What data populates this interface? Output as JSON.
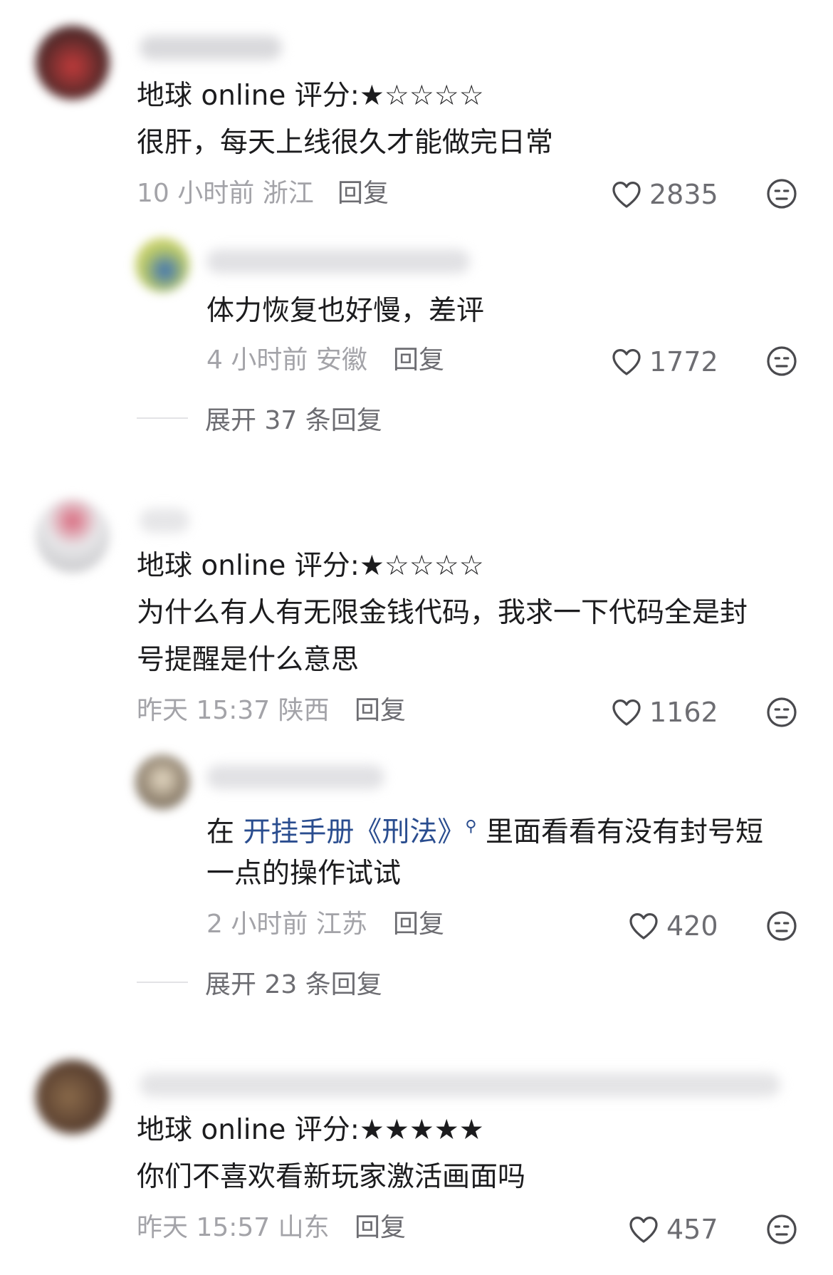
{
  "comments": [
    {
      "rating_line": "地球 online 评分:★☆☆☆☆",
      "body": "很肝，每天上线很久才能做完日常",
      "time": "10 小时前",
      "location": "浙江",
      "reply_label": "回复",
      "likes": "2835",
      "replies": [
        {
          "body": "体力恢复也好慢，差评",
          "time": "4 小时前",
          "location": "安徽",
          "reply_label": "回复",
          "likes": "1772"
        }
      ],
      "expand_label": "展开 37 条回复"
    },
    {
      "rating_line": "地球 online  评分:★☆☆☆☆",
      "body_line1": "为什么有人有无限金钱代码，我求一下代码全是封",
      "body_line2": "号提醒是什么意思",
      "time": "昨天 15:37",
      "location": "陕西",
      "reply_label": "回复",
      "likes": "1162",
      "replies": [
        {
          "body_prefix": "在 ",
          "body_link": "开挂手册《刑法》",
          "body_rest": " 里面看看有没有封号短",
          "body_line2": "一点的操作试试",
          "time": "2 小时前",
          "location": "江苏",
          "reply_label": "回复",
          "likes": "420"
        }
      ],
      "expand_label": "展开 23 条回复"
    },
    {
      "rating_line": "地球 online 评分:★★★★★",
      "body": "你们不喜欢看新玩家激活画面吗",
      "time": "昨天 15:57",
      "location": "山东",
      "reply_label": "回复",
      "likes": "457"
    }
  ],
  "icons": {
    "like": "heart-outline-icon",
    "dislike": "neutral-face-icon"
  },
  "colors": {
    "link": "#2a4d8f",
    "meta": "#a3a3a8",
    "text": "#1c1c1e"
  }
}
